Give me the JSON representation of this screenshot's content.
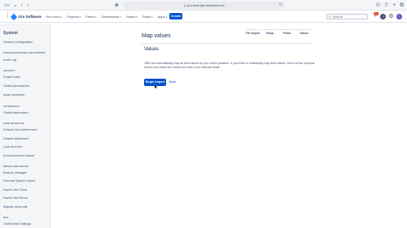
{
  "browser": {
    "url": "jira.example.atlassian.net"
  },
  "topnav": {
    "logo": "Jira Software",
    "items": [
      {
        "label": "Your work"
      },
      {
        "label": "Projects"
      },
      {
        "label": "Filters"
      },
      {
        "label": "Dashboards"
      },
      {
        "label": "Teams"
      },
      {
        "label": "Plans"
      },
      {
        "label": "Apps"
      }
    ],
    "create_label": "Create",
    "search_placeholder": "Search",
    "notification_count": "9+",
    "avatar_initial": "J"
  },
  "sidebar": {
    "title": "System",
    "entries": [
      {
        "type": "item",
        "label": "General configuration"
      },
      {
        "type": "section",
        "label": "TROUBLESHOOTING AND SUPPORT"
      },
      {
        "type": "item",
        "label": "Audit Log"
      },
      {
        "type": "section",
        "label": "SECURITY"
      },
      {
        "type": "item",
        "label": "Project roles"
      },
      {
        "type": "item",
        "label": "Global permissions"
      },
      {
        "type": "item",
        "label": "Issue collectors"
      },
      {
        "type": "section",
        "label": "AUTOMATION"
      },
      {
        "type": "item",
        "label": "Global automation"
      },
      {
        "type": "section",
        "label": "USER INTERFACE"
      },
      {
        "type": "item",
        "label": "Default user preferences"
      },
      {
        "type": "item",
        "label": "Default dashboard"
      },
      {
        "type": "item",
        "label": "Look and feel"
      },
      {
        "type": "item",
        "label": "Announcement banner"
      },
      {
        "type": "section",
        "label": "IMPORT AND EXPORT"
      },
      {
        "type": "item",
        "label": "Backup manager"
      },
      {
        "type": "item",
        "label": "External System Import"
      },
      {
        "type": "item",
        "label": "Import Jira Cloud"
      },
      {
        "type": "item",
        "label": "Import Jira Server"
      },
      {
        "type": "item",
        "label": "Migrate cloud site"
      },
      {
        "type": "section",
        "label": "MAIL"
      },
      {
        "type": "item",
        "label": "Global Mail Settings"
      }
    ]
  },
  "main": {
    "title": "Map values",
    "steps": [
      {
        "label": "File import"
      },
      {
        "label": "Setup"
      },
      {
        "label": "Fields"
      },
      {
        "label": "Values"
      }
    ],
    "section_heading": "Values",
    "description": "JIRA will automatically map all field values for you where possible. If you'd like to individually map field values, return to the previous screen and select the check-box next to the relevant fields.",
    "begin_import_label": "Begin Import",
    "back_label": "Back"
  },
  "colors": {
    "primary": "#0052cc",
    "sidebar_bg": "#f4f5f7",
    "text": "#172b4d",
    "badge": "#de350b"
  }
}
